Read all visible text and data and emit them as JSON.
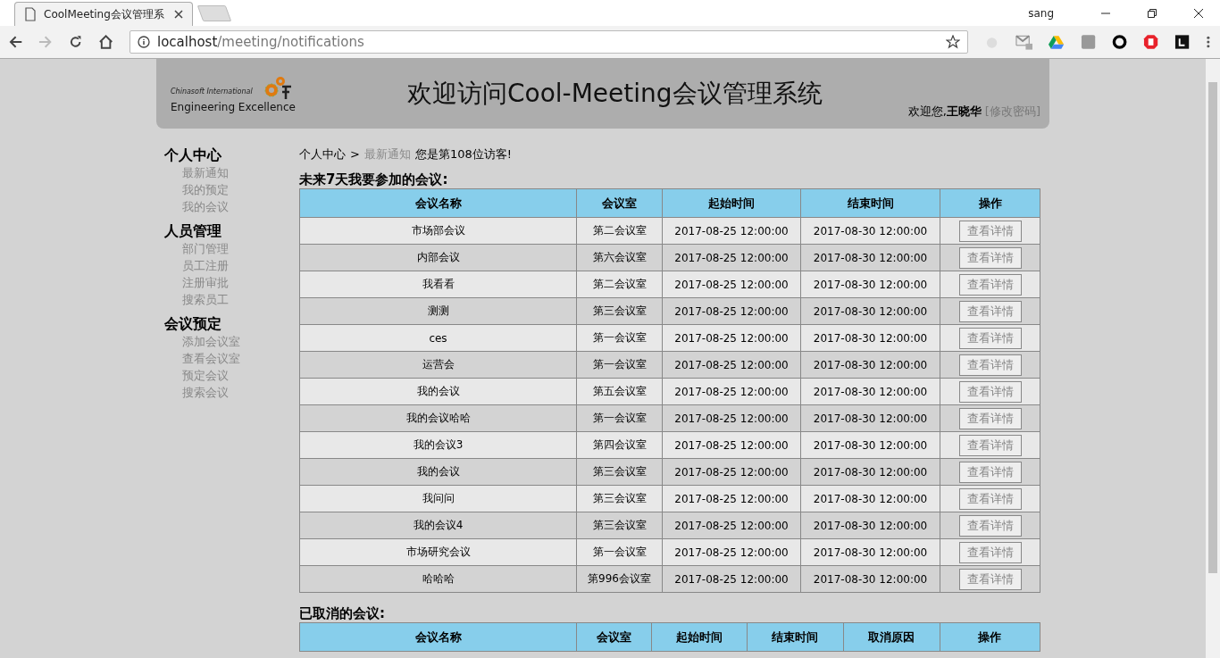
{
  "browser": {
    "tab_title": "CoolMeeting会议管理系",
    "url_host": "localhost",
    "url_path": "/meeting/notifications",
    "profile_name": "sang"
  },
  "header": {
    "logo_line1": "Chinasoft International",
    "logo_line2": "Engineering Excellence",
    "title": "欢迎访问Cool-Meeting会议管理系统",
    "welcome": "欢迎您,",
    "user_name": "王晓华",
    "change_password": "[修改密码]"
  },
  "sidebar": [
    {
      "title": "个人中心",
      "items": [
        {
          "label": "最新通知"
        },
        {
          "label": "我的预定"
        },
        {
          "label": "我的会议"
        }
      ]
    },
    {
      "title": "人员管理",
      "items": [
        {
          "label": "部门管理"
        },
        {
          "label": "员工注册"
        },
        {
          "label": "注册审批"
        },
        {
          "label": "搜索员工"
        }
      ]
    },
    {
      "title": "会议预定",
      "items": [
        {
          "label": "添加会议室"
        },
        {
          "label": "查看会议室"
        },
        {
          "label": "预定会议"
        },
        {
          "label": "搜索会议"
        }
      ]
    }
  ],
  "breadcrumb": {
    "home": "个人中心",
    "separator": ">",
    "current": "最新通知",
    "visitor": "您是第108位访客!"
  },
  "upcoming": {
    "heading": "未来7天我要参加的会议:",
    "columns": [
      "会议名称",
      "会议室",
      "起始时间",
      "结束时间",
      "操作"
    ],
    "rows": [
      {
        "name": "市场部会议",
        "room": "第二会议室",
        "start": "2017-08-25 12:00:00",
        "end": "2017-08-30 12:00:00",
        "action": "查看详情"
      },
      {
        "name": "内部会议",
        "room": "第六会议室",
        "start": "2017-08-25 12:00:00",
        "end": "2017-08-30 12:00:00",
        "action": "查看详情"
      },
      {
        "name": "我看看",
        "room": "第二会议室",
        "start": "2017-08-25 12:00:00",
        "end": "2017-08-30 12:00:00",
        "action": "查看详情"
      },
      {
        "name": "测测",
        "room": "第三会议室",
        "start": "2017-08-25 12:00:00",
        "end": "2017-08-30 12:00:00",
        "action": "查看详情"
      },
      {
        "name": "ces",
        "room": "第一会议室",
        "start": "2017-08-25 12:00:00",
        "end": "2017-08-30 12:00:00",
        "action": "查看详情"
      },
      {
        "name": "运营会",
        "room": "第一会议室",
        "start": "2017-08-25 12:00:00",
        "end": "2017-08-30 12:00:00",
        "action": "查看详情"
      },
      {
        "name": "我的会议",
        "room": "第五会议室",
        "start": "2017-08-25 12:00:00",
        "end": "2017-08-30 12:00:00",
        "action": "查看详情"
      },
      {
        "name": "我的会议哈哈",
        "room": "第一会议室",
        "start": "2017-08-25 12:00:00",
        "end": "2017-08-30 12:00:00",
        "action": "查看详情"
      },
      {
        "name": "我的会议3",
        "room": "第四会议室",
        "start": "2017-08-25 12:00:00",
        "end": "2017-08-30 12:00:00",
        "action": "查看详情"
      },
      {
        "name": "我的会议",
        "room": "第三会议室",
        "start": "2017-08-25 12:00:00",
        "end": "2017-08-30 12:00:00",
        "action": "查看详情"
      },
      {
        "name": "我问问",
        "room": "第三会议室",
        "start": "2017-08-25 12:00:00",
        "end": "2017-08-30 12:00:00",
        "action": "查看详情"
      },
      {
        "name": "我的会议4",
        "room": "第三会议室",
        "start": "2017-08-25 12:00:00",
        "end": "2017-08-30 12:00:00",
        "action": "查看详情"
      },
      {
        "name": "市场研究会议",
        "room": "第一会议室",
        "start": "2017-08-25 12:00:00",
        "end": "2017-08-30 12:00:00",
        "action": "查看详情"
      },
      {
        "name": "哈哈哈",
        "room": "第996会议室",
        "start": "2017-08-25 12:00:00",
        "end": "2017-08-30 12:00:00",
        "action": "查看详情"
      }
    ]
  },
  "cancelled": {
    "heading": "已取消的会议:",
    "columns": [
      "会议名称",
      "会议室",
      "起始时间",
      "结束时间",
      "取消原因",
      "操作"
    ]
  }
}
